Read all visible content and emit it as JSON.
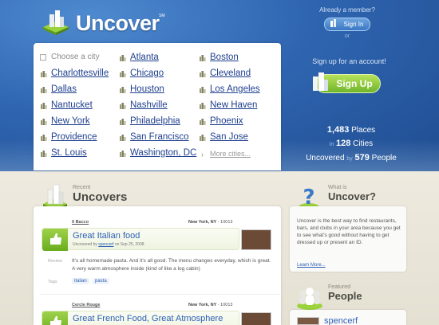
{
  "brand": {
    "name": "Uncover",
    "tm": "SM"
  },
  "member": {
    "question": "Already a member?",
    "signin": "Sign In",
    "or": "or"
  },
  "cities": {
    "placeholder": "Choose a city",
    "list": [
      "Atlanta",
      "Boston",
      "Charlottesville",
      "Chicago",
      "Cleveland",
      "Dallas",
      "Houston",
      "Los Angeles",
      "Nantucket",
      "Nashville",
      "New Haven",
      "New York",
      "Philadelphia",
      "Phoenix",
      "Providence",
      "San Francisco",
      "San Jose",
      "St. Louis",
      "Washington, DC"
    ],
    "more": "More cities..."
  },
  "signup": {
    "prompt": "Sign up for an account!",
    "button": "Sign Up"
  },
  "stats": {
    "places_count": "1,483",
    "places_label": "Places",
    "in_word": "in",
    "cities_count": "128",
    "cities_label": "Cities",
    "uncovered_label": "Uncovered",
    "by_word": "by",
    "people_count": "579",
    "people_label": "People"
  },
  "recent": {
    "small": "Recent",
    "title": "Uncovers"
  },
  "feed": [
    {
      "place": "Il Bacco",
      "location": "New York, NY",
      "zip": "10013",
      "title": "Great Italian food",
      "by_prefix": "Uncovered by",
      "author": "spencerf",
      "date": "on Sep 25, 2008",
      "review_label": "Review",
      "review": "It's all homemade pasta. And it's all good. The menu changes everyday, which is great. A very warm atmosphere inside (kind of like a log cabin)",
      "tags_label": "Tags",
      "tags": [
        "italian",
        "pasta"
      ]
    },
    {
      "place": "Cercle Rouge",
      "location": "New York, NY",
      "zip": "10013",
      "title": "Great French Food, Great Atmosphere"
    }
  ],
  "whatis": {
    "small": "What is",
    "title": "Uncover?",
    "text": "Uncover is the best way to find restaurants, bars, and clubs in your area because you get to see what's good without having to get dressed up or present an ID.",
    "learn_more": "Learn More..."
  },
  "people": {
    "small": "Featured",
    "title": "People",
    "featured_name": "spencerf"
  },
  "colors": {
    "header_blue": "#2f65b0",
    "link_blue": "#1f3f8f",
    "signup_green": "#8cc63f"
  }
}
